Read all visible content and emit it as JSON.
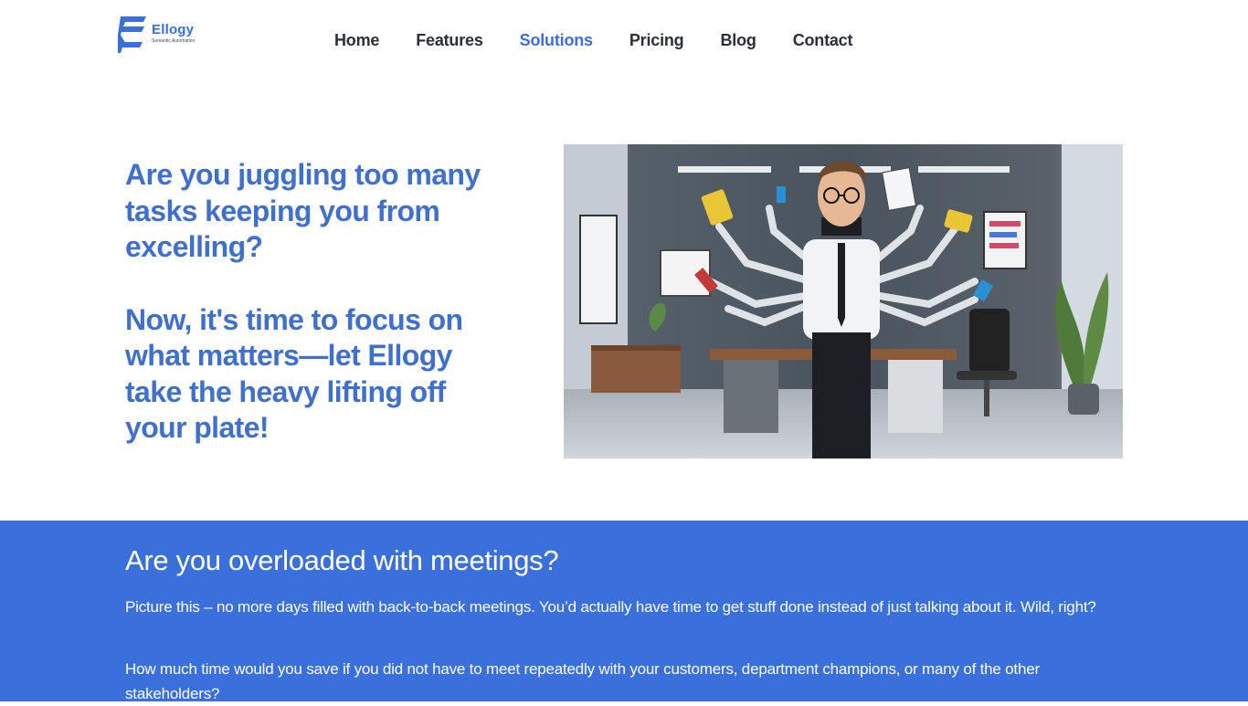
{
  "brand": {
    "name": "Ellogy",
    "tagline": "Semantic Automation",
    "accent": "#3b6fd9"
  },
  "nav": {
    "items": [
      {
        "label": "Home",
        "active": false
      },
      {
        "label": "Features",
        "active": false
      },
      {
        "label": "Solutions",
        "active": true
      },
      {
        "label": "Pricing",
        "active": false
      },
      {
        "label": "Blog",
        "active": false
      },
      {
        "label": "Contact",
        "active": false
      }
    ]
  },
  "hero": {
    "heading1": "Are you juggling too many tasks keeping you from excelling?",
    "heading2": "Now, it's time to focus on what matters—let Ellogy take the heavy lifting off your plate!",
    "image_icon": "office-multitasking-illustration"
  },
  "section": {
    "title": "Are you overloaded with meetings?",
    "paragraph1": "Picture this – no more days filled with back-to-back meetings. You’d actually have time to get stuff done instead of just talking about it.  Wild, right?",
    "paragraph2": "How much time would you save if you did not have to meet repeatedly with your customers, department champions, or many of the other stakeholders?",
    "background": "#3a6fdc"
  }
}
